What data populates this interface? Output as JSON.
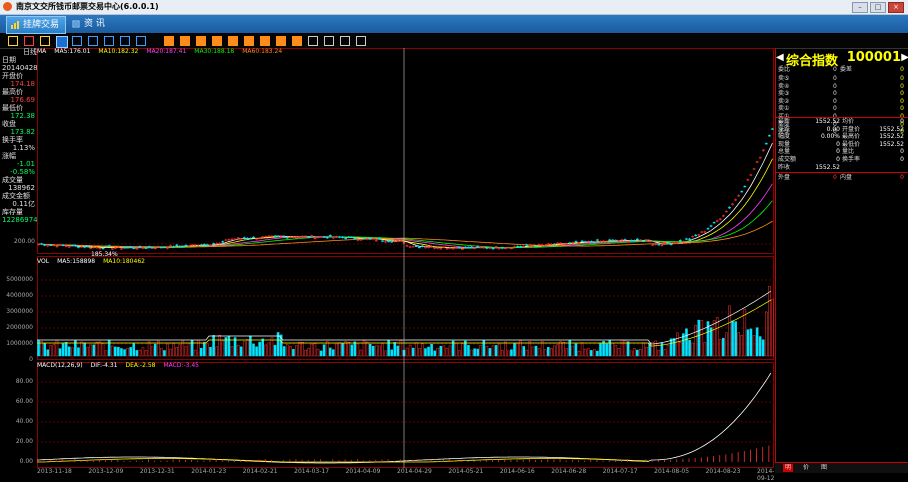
{
  "window": {
    "title": "南京文交所钱币邮票交易中心(6.0.0.1)"
  },
  "menu": {
    "tabs": [
      {
        "label": "挂牌交易"
      },
      {
        "label": "资 讯"
      }
    ]
  },
  "toolbar": {
    "icons": [
      "bar-chart-icon",
      "line-chart-icon",
      "candle-icon",
      "kline-active-icon",
      "window-icon",
      "list-icon",
      "grid-icon",
      "tile-icon",
      "zoom-icon",
      "box1-icon",
      "box2-icon",
      "box3-icon",
      "box4-icon",
      "box5-icon",
      "box6-icon",
      "box7-icon",
      "box8-icon",
      "box9-icon",
      "zoom-in-icon",
      "zoom-out-icon",
      "draw-icon",
      "gear-icon"
    ]
  },
  "left_panel": {
    "period": "日线",
    "rows": [
      {
        "label": "日期",
        "value": "20140428"
      },
      {
        "label": "开盘价",
        "value": "174.18",
        "color": "#ff4040"
      },
      {
        "label": "最高价",
        "value": "176.69",
        "color": "#ff4040"
      },
      {
        "label": "最低价",
        "value": "172.38",
        "color": "#00ff60"
      },
      {
        "label": "收盘",
        "value": "173.82",
        "color": "#00ff60"
      },
      {
        "label": "换手率",
        "value": "1.13%",
        "color": "#e0e0e0"
      },
      {
        "label": "涨幅",
        "value": "-1.01",
        "color": "#00ff60"
      },
      {
        "label": "",
        "value": "-0.58%",
        "color": "#00ff60"
      },
      {
        "label": "成交量",
        "value": "138962",
        "color": "#e0e0e0"
      },
      {
        "label": "成交金额",
        "value": "0.11亿",
        "color": "#e0e0e0"
      },
      {
        "label": "库存量",
        "value": "12286974",
        "color": "#00ff60"
      }
    ]
  },
  "main": {
    "header": [
      {
        "text": "MA",
        "color": "#ffffff"
      },
      {
        "text": "MA5:176.01",
        "color": "#ffffff"
      },
      {
        "text": "MA10:182.32",
        "color": "#ffff00"
      },
      {
        "text": "MA20:187.41",
        "color": "#ff40ff"
      },
      {
        "text": "MA30:188.18",
        "color": "#00ff00"
      },
      {
        "text": "MA60:183.24",
        "color": "#ff8c1a"
      }
    ],
    "price_y_label": "200.00",
    "cursor_price": "185.34%",
    "vol_header": [
      {
        "text": "VOL",
        "color": "#ffffff"
      },
      {
        "text": "MA5:158898",
        "color": "#ffffff"
      },
      {
        "text": "MA10:180462",
        "color": "#ffff00"
      }
    ],
    "vol_y": [
      "5000000",
      "4000000",
      "3000000",
      "2000000",
      "1000000",
      "0"
    ],
    "macd_header": [
      {
        "text": "MACD(12,26,9)",
        "color": "#ffffff"
      },
      {
        "text": "DIF:-4.31",
        "color": "#ffffff"
      },
      {
        "text": "DEA:-2.58",
        "color": "#ffff00"
      },
      {
        "text": "MACD:-3.45",
        "color": "#ff40ff"
      }
    ],
    "macd_y": [
      "80.00",
      "60.00",
      "40.00",
      "20.00",
      "0.00"
    ],
    "x_dates": [
      "2013-11-18",
      "2013-12-09",
      "2013-12-31",
      "2014-01-23",
      "2014-02-21",
      "2014-03-17",
      "2014-04-09",
      "2014-04-29",
      "2014-05-21",
      "2014-06-16",
      "2014-06-28",
      "2014-07-17",
      "2014-08-05",
      "2014-08-23",
      "2014-09-12"
    ]
  },
  "quote": {
    "title": "综合指数",
    "code": "100001",
    "orders": [
      {
        "label": "委比",
        "v1": "0",
        "mid": "委差",
        "v2": "0"
      },
      {
        "label": "卖⑤",
        "v1": "0",
        "v2": "0"
      },
      {
        "label": "卖④",
        "v1": "0",
        "v2": "0"
      },
      {
        "label": "卖③",
        "v1": "0",
        "v2": "0"
      },
      {
        "label": "卖②",
        "v1": "0",
        "v2": "0"
      },
      {
        "label": "卖①",
        "v1": "0",
        "v2": "0"
      },
      {
        "label": "买①",
        "v1": "0",
        "v2": "0"
      },
      {
        "label": "买②",
        "v1": "0",
        "v2": "0"
      },
      {
        "label": "买③",
        "v1": "0",
        "v2": "0"
      }
    ],
    "stats": [
      {
        "l1": "最新",
        "v1": "1552.52",
        "l2": "均价",
        "v2": "0"
      },
      {
        "l1": "涨跌",
        "v1": "0.00",
        "l2": "开盘价",
        "v2": "1552.52"
      },
      {
        "l1": "幅度",
        "v1": "0.00%",
        "l2": "最高价",
        "v2": "1552.52"
      },
      {
        "l1": "现量",
        "v1": "0",
        "l2": "最低价",
        "v2": "1552.52"
      },
      {
        "l1": "总量",
        "v1": "0",
        "l2": "量比",
        "v2": "0"
      },
      {
        "l1": "成交额",
        "v1": "0",
        "l2": "换手率",
        "v2": "0"
      },
      {
        "l1": "昨收",
        "v1": "1552.52",
        "l2": "",
        "v2": ""
      }
    ],
    "outer": {
      "l1": "外盘",
      "v1": "0",
      "l2": "内盘",
      "v2": "0"
    },
    "bottom_tabs": [
      "明",
      "价",
      "图"
    ]
  },
  "chart_data": {
    "type": "candlestick",
    "ma_colors": {
      "ma5": "#ffffff",
      "ma10": "#ffff00",
      "ma20": "#ff40ff",
      "ma30": "#00ff00",
      "ma60": "#ff8c1a"
    },
    "up_color": "#ff3030",
    "down_color": "#00e5ff"
  }
}
